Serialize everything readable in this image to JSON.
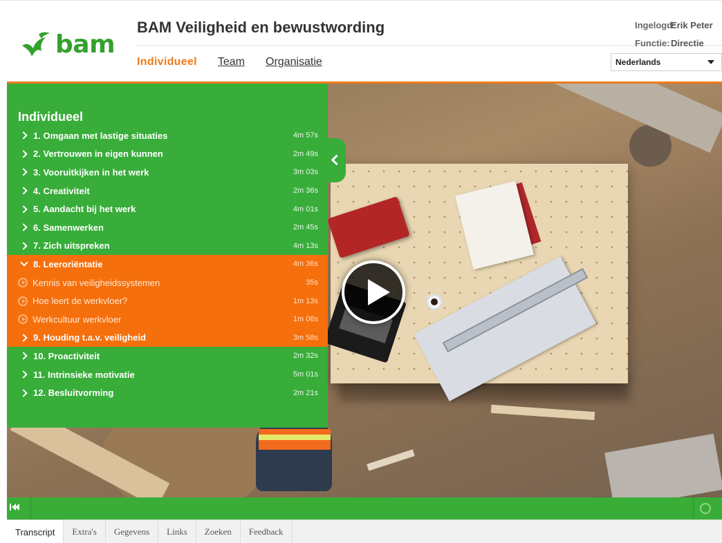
{
  "header": {
    "logo_text": "bam",
    "title": "BAM Veiligheid en bewustwording",
    "nav": [
      "Individueel",
      "Team",
      "Organisatie"
    ],
    "user": {
      "logged_in_label": "Ingelogd:",
      "logged_in_value": "Erik Peter",
      "function_label": "Functie:",
      "function_value": "Directie"
    },
    "language": "Nederlands"
  },
  "panel": {
    "title": "Individueel",
    "items": [
      {
        "label": "1. Omgaan met lastige situaties",
        "duration": "4m 57s"
      },
      {
        "label": "2. Vertrouwen in eigen kunnen",
        "duration": "2m 49s"
      },
      {
        "label": "3. Vooruitkijken in het werk",
        "duration": "3m 03s"
      },
      {
        "label": "4. Creativiteit",
        "duration": "2m 36s"
      },
      {
        "label": "5. Aandacht bij het werk",
        "duration": "4m 01s"
      },
      {
        "label": "6. Samenwerken",
        "duration": "2m 45s"
      },
      {
        "label": "7. Zich uitspreken",
        "duration": "4m 13s"
      },
      {
        "label": "8. Leeroriëntatie",
        "duration": "4m 36s"
      },
      {
        "label": "Kennis van veiligheidssystemen",
        "duration": "35s"
      },
      {
        "label": "Hoe leert de werkvloer?",
        "duration": "1m 13s"
      },
      {
        "label": "Werkcultuur werkvloer",
        "duration": "1m 06s"
      },
      {
        "label": "9. Houding t.a.v. veiligheid",
        "duration": "3m 58s"
      },
      {
        "label": "10. Proactiviteit",
        "duration": "2m 32s"
      },
      {
        "label": "11. Intrinsieke motivatie",
        "duration": "5m 01s"
      },
      {
        "label": "12. Besluitvorming",
        "duration": "2m 21s"
      }
    ]
  },
  "tabs": [
    "Transcript",
    "Extra's",
    "Gegevens",
    "Links",
    "Zoeken",
    "Feedback"
  ],
  "colors": {
    "brand_green": "#38ad3a",
    "accent_orange": "#f56f0c"
  }
}
